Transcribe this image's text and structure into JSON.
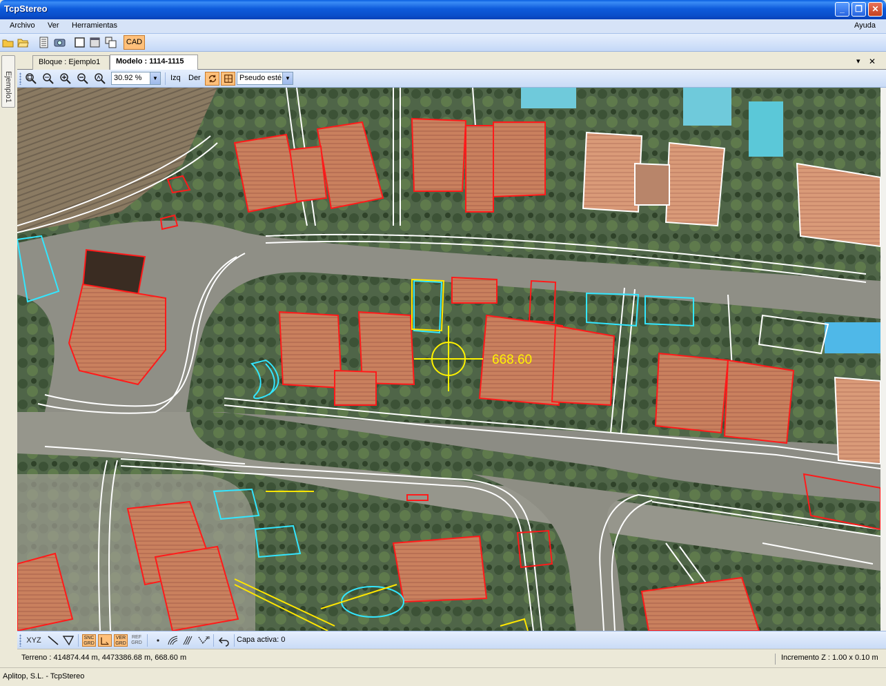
{
  "window": {
    "title": "TcpStereo",
    "minimize": "_",
    "restore": "❐",
    "close": "✕"
  },
  "menu": {
    "items": [
      "Archivo",
      "Ver",
      "Herramientas"
    ],
    "help": "Ayuda"
  },
  "toolbar": {
    "cad_label": "CAD"
  },
  "sidebar": {
    "tab_label": "Ejemplo1"
  },
  "tabs": {
    "block_tab": "Bloque : Ejemplo1",
    "model_tab": "Modelo : 1114-1115",
    "menu_glyph": "▾",
    "close_glyph": "✕"
  },
  "viewbar": {
    "zoom_value": "30.92 %",
    "left_label": "Izq",
    "right_label": "Der",
    "mode_value": "Pseudo esté"
  },
  "map": {
    "cursor_elevation": "668.60"
  },
  "cadbar": {
    "xyz_label": "XYZ",
    "snap_grid": [
      "SNC",
      "GRD"
    ],
    "ortho_grid": [
      "ORT",
      "GRD"
    ],
    "ver_grid": [
      "VER",
      "GRD"
    ],
    "ref_grid": [
      "REF",
      "GRD"
    ],
    "active_layer": "Capa activa: 0"
  },
  "status": {
    "terrain": "Terreno : 414874.44 m, 4473386.68 m, 668.60 m",
    "increment": "Incremento Z : 1.00 x 0.10 m",
    "footer": "Aplitop, S.L. - TcpStereo"
  },
  "colors": {
    "building_outline": "#FF1A1A",
    "pool_outline": "#33E6FF",
    "road_lines": "#FFFFFF",
    "cursor": "#FFF200",
    "accent": "#FFC07A"
  }
}
